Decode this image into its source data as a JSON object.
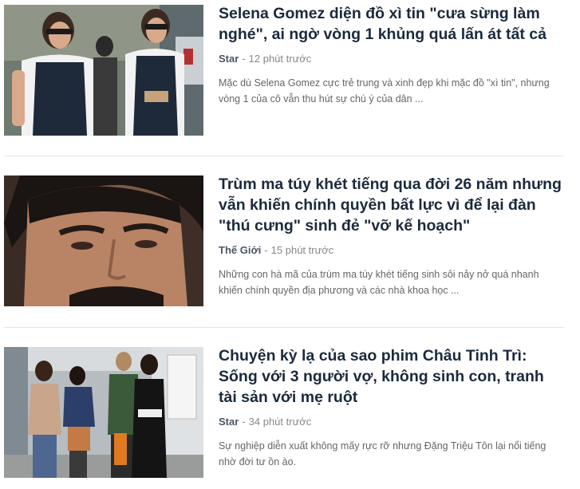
{
  "articles": [
    {
      "title": "Selena Gomez diện đồ xì tin \"cưa sừng làm nghé\", ai ngờ vòng 1 khủng quá lấn át tất cả",
      "category": "Star",
      "separator": "-",
      "time": "12 phút trước",
      "excerpt": "Mặc dù Selena Gomez cực trẻ trung và xinh đẹp khi mặc đồ \"xì tin\", nhưng vòng 1 của cô vẫn thu hút sự chú ý của dân ..."
    },
    {
      "title": "Trùm ma túy khét tiếng qua đời 26 năm nhưng vẫn khiến chính quyền bất lực vì để lại đàn \"thú cưng\" sinh đẻ \"vỡ kế hoạch\"",
      "category": "Thế Giới",
      "separator": "-",
      "time": "15 phút trước",
      "excerpt": "Những con hà mã của trùm ma túy khét tiếng sinh sôi nảy nở quá nhanh khiến chính quyền địa phương và các nhà khoa học ..."
    },
    {
      "title": "Chuyện kỳ lạ của sao phim Châu Tinh Trì: Sống với 3 người vợ, không sinh con, tranh tài sản với mẹ ruột",
      "category": "Star",
      "separator": "-",
      "time": "34 phút trước",
      "excerpt": "Sự nghiệp diễn xuất không mấy rực rỡ nhưng Đặng Triệu Tôn lại nổi tiếng nhờ đời tư ồn ào."
    }
  ]
}
